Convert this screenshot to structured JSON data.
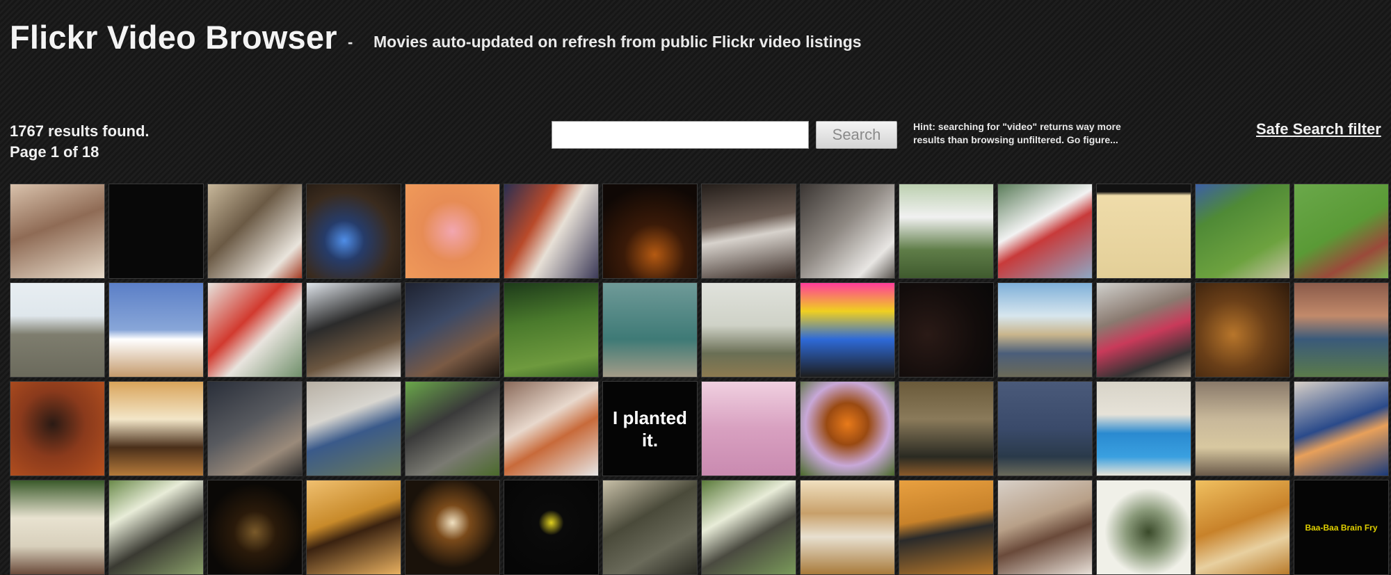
{
  "header": {
    "title": "Flickr Video Browser",
    "separator": "-",
    "tagline": "Movies auto-updated on refresh from public Flickr video listings"
  },
  "results": {
    "count": "1767 results found.",
    "page": "Page 1 of 18"
  },
  "search": {
    "value": "",
    "button_label": "Search"
  },
  "hint": "Hint: searching for \"video\" returns way more results than browsing unfiltered. Go figure...",
  "safe_search_label": "Safe Search filter",
  "thumbnails": [
    {
      "bg": "linear-gradient(160deg,#d9c2ac 0%,#8f6b55 45%,#e8dccb 100%)"
    },
    {
      "bg": "#080808"
    },
    {
      "bg": "linear-gradient(135deg,#c7b79a 0%,#6b5a45 40%,#e9e4dc 80%,#a33a22 100%)"
    },
    {
      "bg": "radial-gradient(circle at 40% 60%,#4f8ee8 0%,#263c6a 25%,#3a2b1e 60%,#1b140e 100%)"
    },
    {
      "bg": "radial-gradient(circle at 50% 50%,#f2a6b0 0%,#e78c55 45%,#f09a5a 100%)"
    },
    {
      "bg": "linear-gradient(120deg,#2b2f52 0%,#b94a2a 35%,#e7e0d6 55%,#3c3a58 100%)"
    },
    {
      "bg": "radial-gradient(circle at 55% 75%,#b55a12 0%,#3a1a08 35%,#0f0805 80%)"
    },
    {
      "bg": "linear-gradient(170deg,#241e1a 0%,#6d5e55 40%,#d7d2cc 55%,#3a2c26 100%)"
    },
    {
      "bg": "linear-gradient(135deg,#3b3633 0%,#8f8983 45%,#e8e6e3 80%,#5a5550 100%)"
    },
    {
      "bg": "linear-gradient(180deg,#bcd0b0 0%,#f1f1f1 35%,#5f7d48 70%,#3f5a2e 100%)"
    },
    {
      "bg": "linear-gradient(150deg,#5b7d5a 0%,#f2f2f2 40%,#c83a3a 55%,#8fa7c4 100%)"
    },
    {
      "bg": "linear-gradient(180deg,#111 0%,#111 8%,#efdcaa 12%,#e3cf98 100%)"
    },
    {
      "bg": "linear-gradient(150deg,#3c5fa6 0%,#4f8a36 30%,#6da23f 70%,#c9c3a7 100%)"
    },
    {
      "bg": "linear-gradient(150deg,#6aa84a 0%,#5a9a36 50%,#9a4a3a 75%,#7bb050 100%)"
    },
    {
      "bg": "linear-gradient(180deg,#e8eef2 0%,#dfe7ec 35%,#7e7d6e 55%,#6b6a5c 100%)"
    },
    {
      "bg": "linear-gradient(180deg,#5b7fc7 0%,#88a6d8 50%,#ffffff 60%,#c49a6c 100%)"
    },
    {
      "bg": "linear-gradient(135deg,#e6e2dc 0%,#d23a2f 40%,#e8e4de 60%,#6f8f6a 100%)"
    },
    {
      "bg": "linear-gradient(160deg,#dfe4ea 0%,#2b2b2b 40%,#6b5640 70%,#e8e4de 100%)"
    },
    {
      "bg": "linear-gradient(150deg,#1e2230 0%,#3d4a66 40%,#7a5a44 70%,#1a1410 100%)"
    },
    {
      "bg": "linear-gradient(170deg,#1d3a1a 0%,#4a7a2c 40%,#6e9a3e 80%,#3d6a28 100%)"
    },
    {
      "bg": "linear-gradient(180deg,#6f9a98 0%,#3e7a76 60%,#a49c88 100%)"
    },
    {
      "bg": "linear-gradient(180deg,#e0e2dc 0%,#cfd2c7 45%,#6a6f55 75%,#8c7a50 100%)"
    },
    {
      "bg": "linear-gradient(180deg,#ff3c9a 0%,#f0d020 30%,#2e6ad8 60%,#1d1d1d 100%)"
    },
    {
      "bg": "radial-gradient(circle at 30% 55%,#2a1a16 0%,#120c0b 60%,#080808 100%)"
    },
    {
      "bg": "linear-gradient(180deg,#7fb0d9 0%,#d7e6ee 35%,#c9b58c 55%,#4b5e7a 75%,#6b6a58 100%)"
    },
    {
      "bg": "linear-gradient(160deg,#d0d0cc 0%,#8a7a70 35%,#c93a5a 55%,#333 80%,#a89a88 100%)"
    },
    {
      "bg": "radial-gradient(circle at 40% 55%,#b8762b 0%,#6a3f18 45%,#2e1a0b 100%)"
    },
    {
      "bg": "linear-gradient(180deg,#8a5a4a 0%,#c28a6a 35%,#3a5a7a 60%,#5a7a4a 100%)"
    },
    {
      "bg": "radial-gradient(circle at 45% 45%,#2a1a14 0%,#8a3a1c 45%,#b8521f 100%)"
    },
    {
      "bg": "linear-gradient(180deg,#d9a45a 0%,#f3e6c8 40%,#4a2f1a 70%,#b57a3a 100%)"
    },
    {
      "bg": "linear-gradient(150deg,#2a2f3a 0%,#585a5f 45%,#9a8a7a 75%,#2a2a2a 100%)"
    },
    {
      "bg": "linear-gradient(160deg,#b8b0a4 0%,#d8d6d0 35%,#3a5a8a 55%,#6a7a5a 100%)"
    },
    {
      "bg": "linear-gradient(150deg,#6aa74a 0%,#3a3a3a 40%,#7a7a72 70%,#4a6a2a 100%)"
    },
    {
      "bg": "linear-gradient(150deg,#8a6a5a 0%,#e8d8cc 40%,#c86a3a 60%,#e6e6e6 100%)"
    },
    {
      "bg": "#050505",
      "caption": "I planted it."
    },
    {
      "bg": "linear-gradient(180deg,#f0d0e0 0%,#d8a0c0 50%,#c98ab0 100%)"
    },
    {
      "bg": "radial-gradient(circle at 50% 45%,#e87a1a 0%,#9a4a12 30%,#c8a8d8 60%,#4a6a2a 100%)"
    },
    {
      "bg": "linear-gradient(180deg,#6a5a3a 0%,#8a7a5a 40%,#2a2a22 80%,#8a5a2a 100%)"
    },
    {
      "bg": "linear-gradient(180deg,#4a5a7a 0%,#3a4a6a 50%,#2a3a4a 80%,#6a6a5a 100%)"
    },
    {
      "bg": "linear-gradient(180deg,#d8d4c8 0%,#e6e2d8 35%,#2a8ad0 55%,#3aa0e0 80%,#e8e4d8 100%)"
    },
    {
      "bg": "linear-gradient(180deg,#8a7a6a 0%,#c8b89a 40%,#d8c8a0 70%,#6a5a4a 100%)"
    },
    {
      "bg": "linear-gradient(160deg,#d8d0c8 0%,#2a4a8a 45%,#e8a05a 60%,#1a3a7a 100%)"
    },
    {
      "bg": "linear-gradient(180deg,#3a5a2a 0%,#e8e2d0 40%,#d8d0bc 70%,#6a4a3a 100%)"
    },
    {
      "bg": "linear-gradient(150deg,#6a8a4a 0%,#e8ecd8 30%,#3a3a32 60%,#8aa06a 100%)"
    },
    {
      "bg": "radial-gradient(circle at 50% 55%,#7a5a2a 0%,#2a1a0a 30%,#0a0806 70%)"
    },
    {
      "bg": "linear-gradient(160deg,#f0c070 0%,#c88a2a 40%,#3a2210 55%,#e8b060 100%)"
    },
    {
      "bg": "radial-gradient(circle at 50% 45%,#f0e0c0 0%,#7a4a1a 25%,#1a120a 65%)"
    },
    {
      "bg": "radial-gradient(circle at 50% 45%,#e0d020 0%,#0a0a0a 18%,#050505 100%)"
    },
    {
      "bg": "linear-gradient(150deg,#c8c0a8 0%,#4a4a3a 40%,#6a6a5a 70%,#2a2a22 100%)"
    },
    {
      "bg": "linear-gradient(150deg,#5a7a3a 0%,#e8ecd8 35%,#4a4a40 60%,#7a9a5a 100%)"
    },
    {
      "bg": "linear-gradient(180deg,#f0e0c0 0%,#c8a06a 35%,#e8e0d0 60%,#a87a3a 100%)"
    },
    {
      "bg": "linear-gradient(170deg,#e8a040 0%,#c8822a 40%,#2a2a2a 55%,#b8782a 100%)"
    },
    {
      "bg": "linear-gradient(160deg,#d8d0c8 0%,#b8a088 40%,#6a4a3a 60%,#e8e0d8 100%)"
    },
    {
      "bg": "radial-gradient(circle at 55% 55%,#3a4a2a 0%,#8a9a7a 30%,#f0f0e8 60%)"
    },
    {
      "bg": "linear-gradient(160deg,#f0c060 0%,#c8822a 45%,#e8d0a0 70%,#b87a2a 100%)"
    },
    {
      "bg": "#050505",
      "caption": "Baa-Baa Brain Fry",
      "small": true
    }
  ]
}
